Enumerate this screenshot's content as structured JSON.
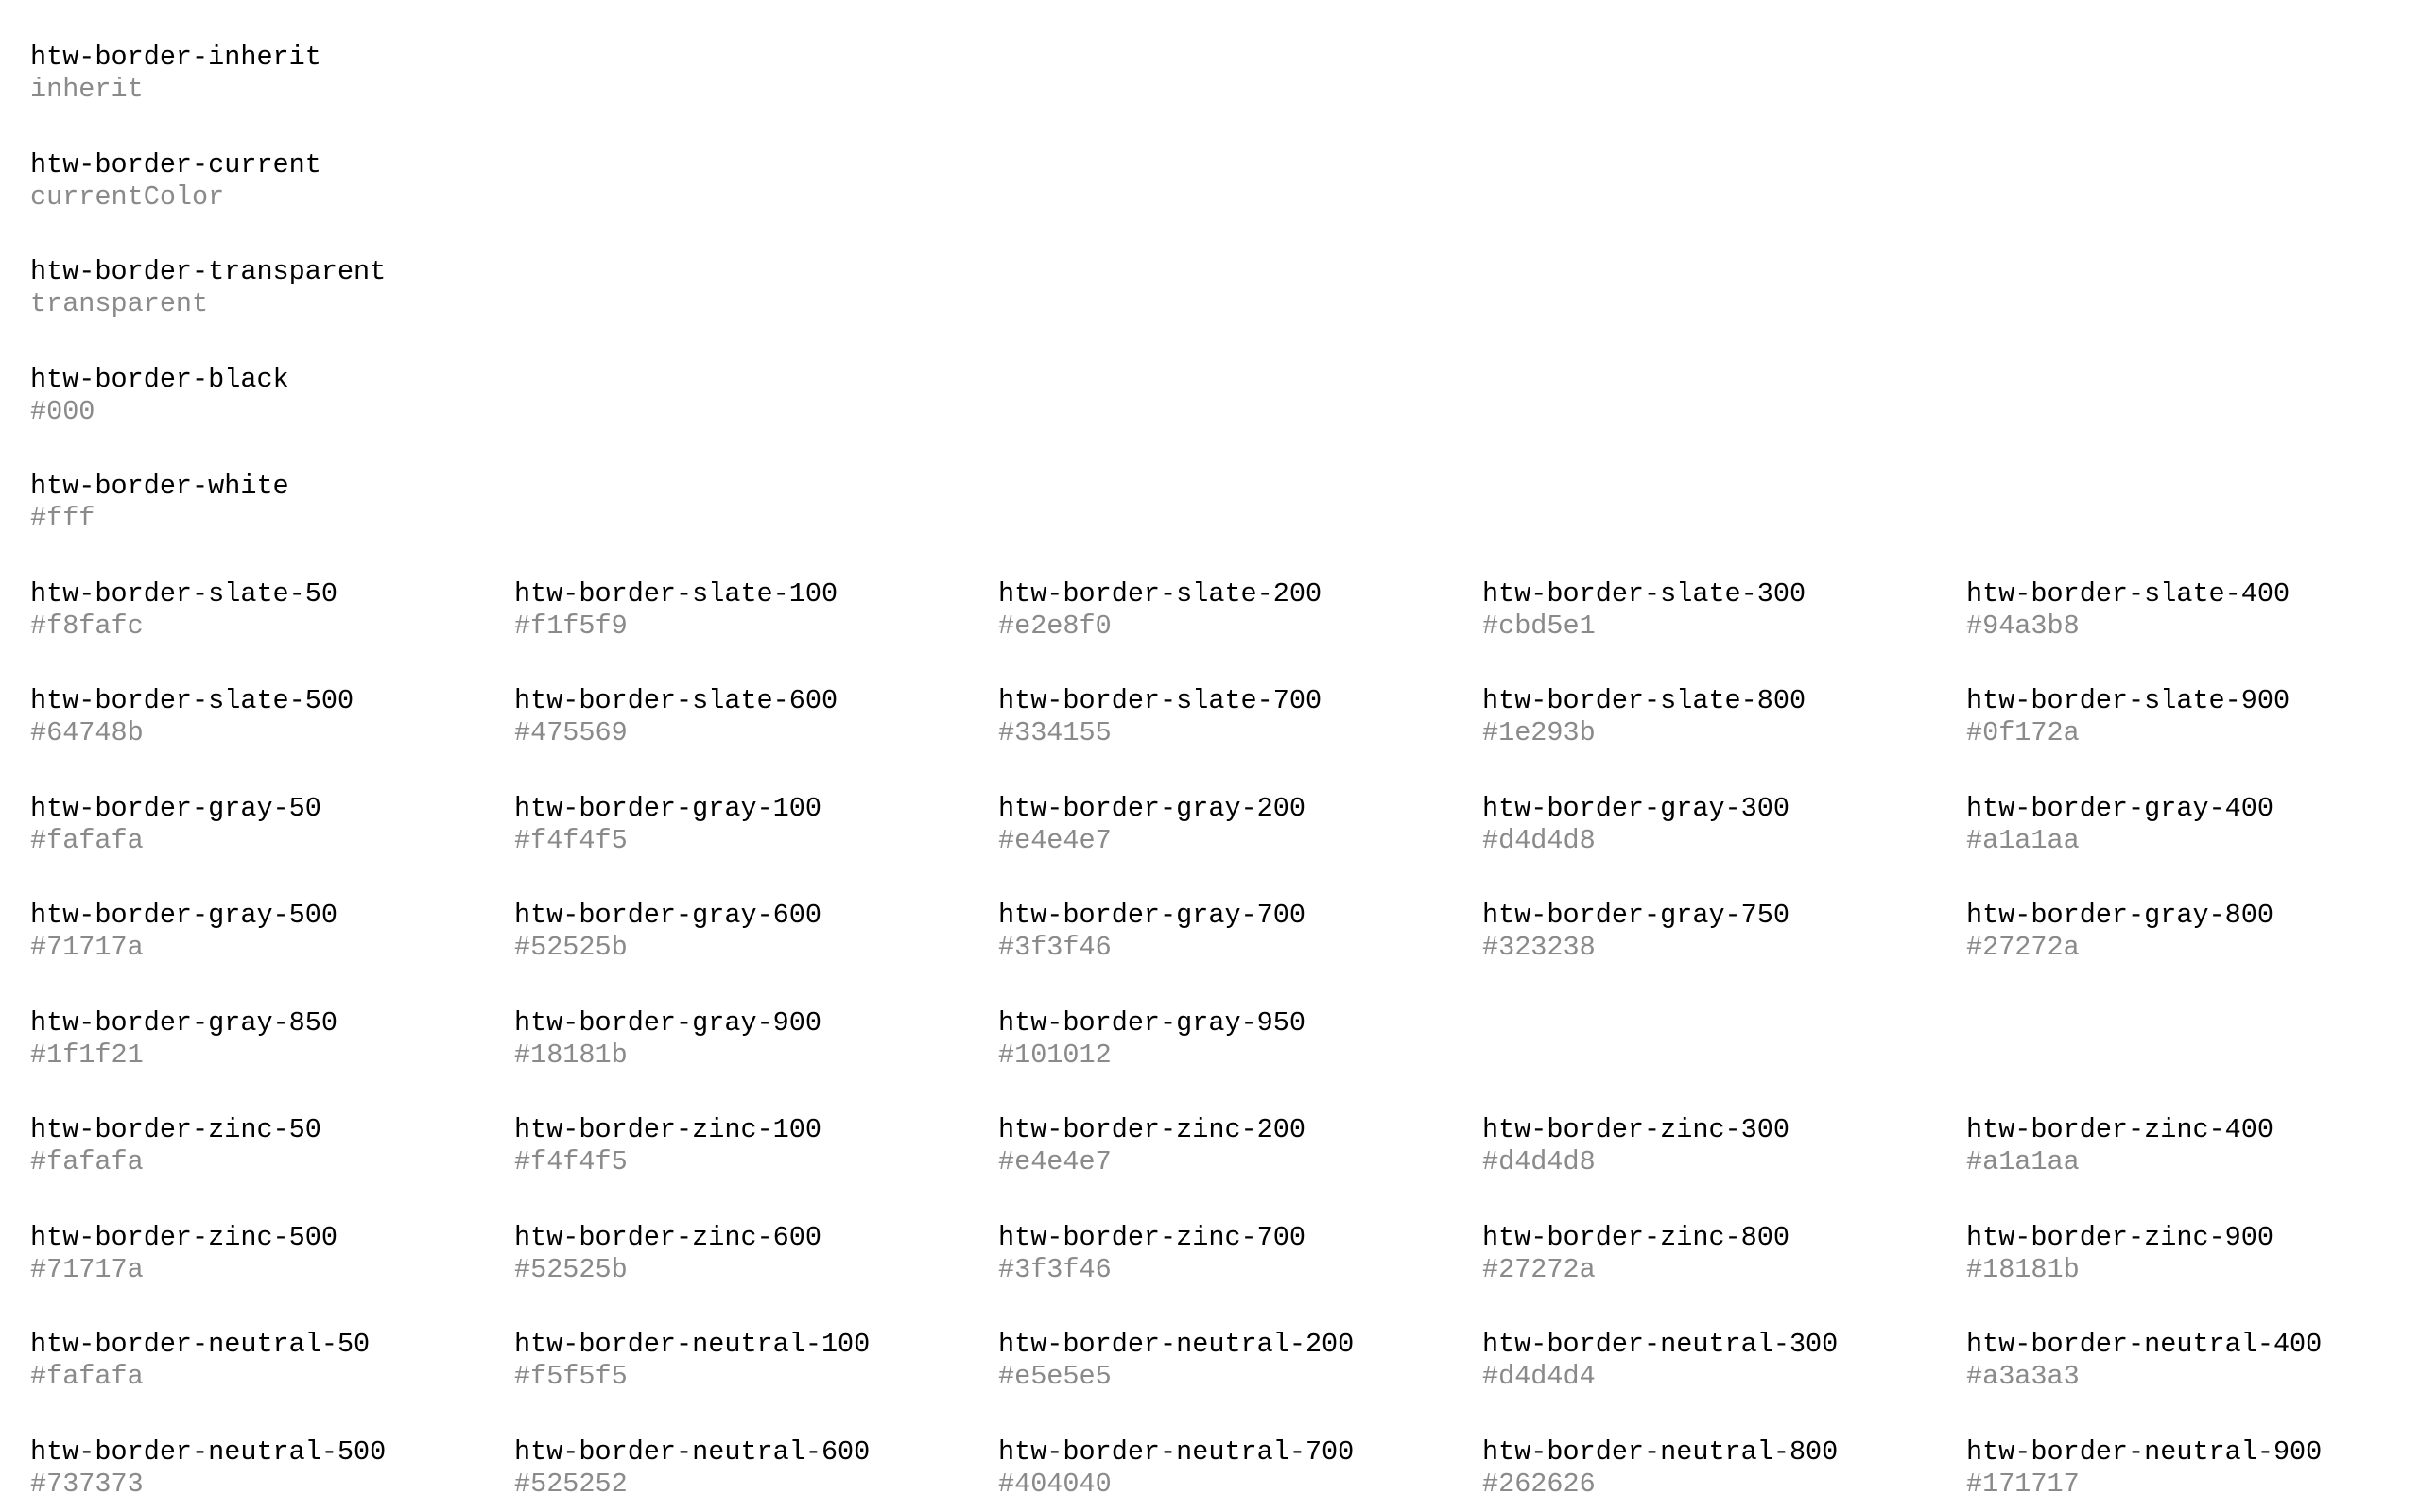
{
  "tokens": [
    {
      "name": "htw-border-inherit",
      "value": "inherit"
    },
    {
      "name": "htw-border-current",
      "value": "currentColor"
    },
    {
      "name": "htw-border-transparent",
      "value": "transparent"
    },
    {
      "name": "htw-border-black",
      "value": "#000"
    },
    {
      "name": "htw-border-white",
      "value": "#fff"
    },
    {
      "name": "htw-border-slate-50",
      "value": "#f8fafc"
    },
    {
      "name": "htw-border-slate-100",
      "value": "#f1f5f9"
    },
    {
      "name": "htw-border-slate-200",
      "value": "#e2e8f0"
    },
    {
      "name": "htw-border-slate-300",
      "value": "#cbd5e1"
    },
    {
      "name": "htw-border-slate-400",
      "value": "#94a3b8"
    },
    {
      "name": "htw-border-slate-500",
      "value": "#64748b"
    },
    {
      "name": "htw-border-slate-600",
      "value": "#475569"
    },
    {
      "name": "htw-border-slate-700",
      "value": "#334155"
    },
    {
      "name": "htw-border-slate-800",
      "value": "#1e293b"
    },
    {
      "name": "htw-border-slate-900",
      "value": "#0f172a"
    },
    {
      "name": "htw-border-gray-50",
      "value": "#fafafa"
    },
    {
      "name": "htw-border-gray-100",
      "value": "#f4f4f5"
    },
    {
      "name": "htw-border-gray-200",
      "value": "#e4e4e7"
    },
    {
      "name": "htw-border-gray-300",
      "value": "#d4d4d8"
    },
    {
      "name": "htw-border-gray-400",
      "value": "#a1a1aa"
    },
    {
      "name": "htw-border-gray-500",
      "value": "#71717a"
    },
    {
      "name": "htw-border-gray-600",
      "value": "#52525b"
    },
    {
      "name": "htw-border-gray-700",
      "value": "#3f3f46"
    },
    {
      "name": "htw-border-gray-750",
      "value": "#323238"
    },
    {
      "name": "htw-border-gray-800",
      "value": "#27272a"
    },
    {
      "name": "htw-border-gray-850",
      "value": "#1f1f21"
    },
    {
      "name": "htw-border-gray-900",
      "value": "#18181b"
    },
    {
      "name": "htw-border-gray-950",
      "value": "#101012"
    },
    {
      "name": "htw-border-zinc-50",
      "value": "#fafafa"
    },
    {
      "name": "htw-border-zinc-100",
      "value": "#f4f4f5"
    },
    {
      "name": "htw-border-zinc-200",
      "value": "#e4e4e7"
    },
    {
      "name": "htw-border-zinc-300",
      "value": "#d4d4d8"
    },
    {
      "name": "htw-border-zinc-400",
      "value": "#a1a1aa"
    },
    {
      "name": "htw-border-zinc-500",
      "value": "#71717a"
    },
    {
      "name": "htw-border-zinc-600",
      "value": "#52525b"
    },
    {
      "name": "htw-border-zinc-700",
      "value": "#3f3f46"
    },
    {
      "name": "htw-border-zinc-800",
      "value": "#27272a"
    },
    {
      "name": "htw-border-zinc-900",
      "value": "#18181b"
    },
    {
      "name": "htw-border-neutral-50",
      "value": "#fafafa"
    },
    {
      "name": "htw-border-neutral-100",
      "value": "#f5f5f5"
    },
    {
      "name": "htw-border-neutral-200",
      "value": "#e5e5e5"
    },
    {
      "name": "htw-border-neutral-300",
      "value": "#d4d4d4"
    },
    {
      "name": "htw-border-neutral-400",
      "value": "#a3a3a3"
    },
    {
      "name": "htw-border-neutral-500",
      "value": "#737373"
    },
    {
      "name": "htw-border-neutral-600",
      "value": "#525252"
    },
    {
      "name": "htw-border-neutral-700",
      "value": "#404040"
    },
    {
      "name": "htw-border-neutral-800",
      "value": "#262626"
    },
    {
      "name": "htw-border-neutral-900",
      "value": "#171717"
    }
  ]
}
